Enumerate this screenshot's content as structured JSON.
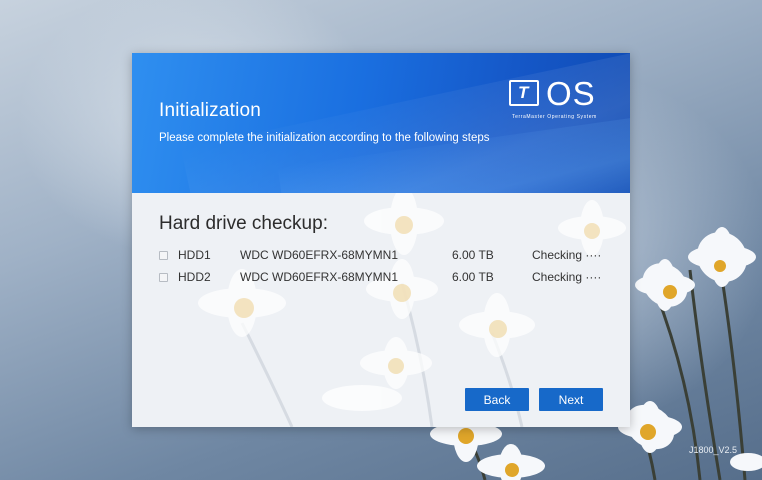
{
  "dialog": {
    "title": "Initialization",
    "subtitle": "Please complete the initialization according to the following steps",
    "logo": {
      "mark_letter": "T",
      "text": "OS",
      "tagline": "TerraMaster Operating System"
    },
    "section_title": "Hard drive checkup:",
    "drives": [
      {
        "name": "HDD1",
        "model": "WDC WD60EFRX-68MYMN1",
        "size": "6.00 TB",
        "status": "Checking ····"
      },
      {
        "name": "HDD2",
        "model": "WDC WD60EFRX-68MYMN1",
        "size": "6.00 TB",
        "status": "Checking ····"
      }
    ],
    "buttons": {
      "back": "Back",
      "next": "Next"
    }
  },
  "footer": {
    "version": "J1800_V2.5"
  },
  "colors": {
    "banner_blue": "#1a6fe0",
    "button_blue": "#1769c9",
    "dialog_bg": "#eef1f5"
  }
}
